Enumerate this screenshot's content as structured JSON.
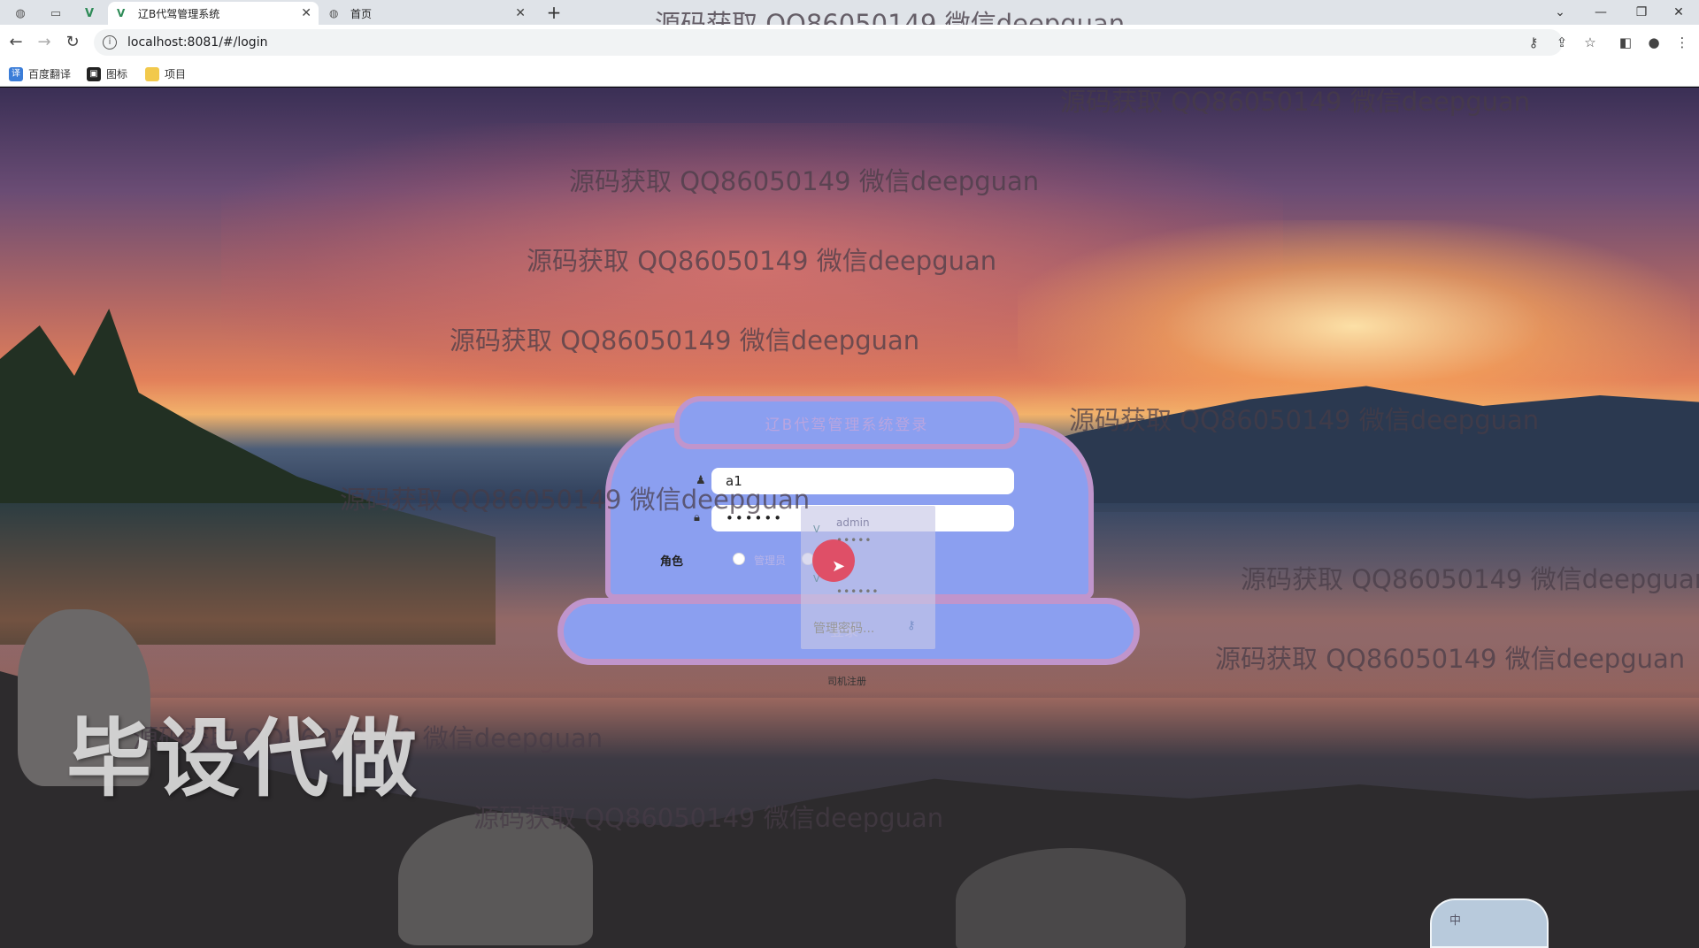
{
  "browser": {
    "tabs": [
      {
        "label": "辽B代驾管理系统",
        "active": true
      },
      {
        "label": "首页",
        "active": false
      }
    ],
    "url": "localhost:8081/#/login",
    "bookmarks": [
      "百度翻译",
      "图标",
      "项目"
    ]
  },
  "watermarks": [
    "源码获取 QQ86050149 微信deepguan",
    "源码获取 QQ86050149 微信deepguan",
    "源码获取 QQ86050149 微信deepguan",
    "源码获取 QQ86050149 微信deepguan",
    "源码获取 QQ86050149 微信deepguan",
    "源码获取 QQ86050149 微信deepguan",
    "源码获取 QQ86050149 微信deepguan",
    "源码获取 QQ86050149 微信deepguan",
    "源码获取 QQ86050149 微信deepguan",
    "源码获取 QQ86050149 微信deepguan",
    "源码获取 QQ86050149 微信deepguan"
  ],
  "brand_overlay": "毕设代做",
  "login": {
    "username_value": "a1",
    "password_value": "••••••",
    "role_label": "角色",
    "role_options": [
      "管理员"
    ],
    "login_button": "登录",
    "register_link": "司机注册"
  },
  "autofill": {
    "user": "admin",
    "dots1": "•••••",
    "dots2": "••••••",
    "manage": "管理密码..."
  },
  "ime": {
    "label": "中"
  }
}
